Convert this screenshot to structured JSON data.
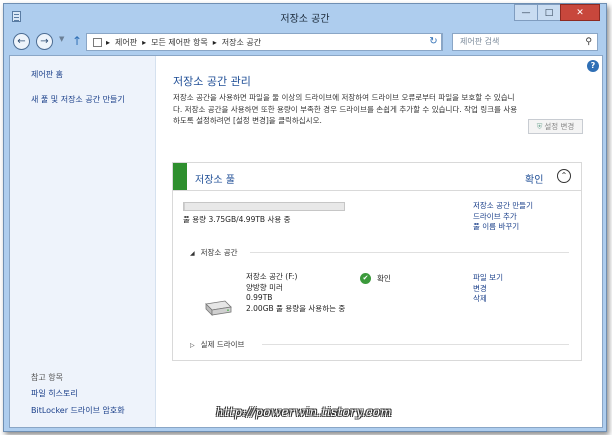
{
  "window": {
    "title": "저장소 공간",
    "buttons": {
      "minimize": "—",
      "maximize": "□",
      "close": "✕"
    }
  },
  "address_bar": {
    "back": "←",
    "forward": "→",
    "up": "↑",
    "path": [
      "제어판",
      "모든 제어판 항목",
      "저장소 공간"
    ],
    "separator": "▸",
    "refresh": "↻",
    "search_placeholder": "제어판 검색",
    "search_icon": "magnifier-icon"
  },
  "sidebar": {
    "home_link": "제어판 홈",
    "create_link": "새 풀 및 저장소 공간 만들기",
    "see_also_header": "참고 항목",
    "see_also": [
      "파일 히스토리",
      "BitLocker 드라이브 암호화"
    ]
  },
  "main": {
    "heading": "저장소 공간 관리",
    "description": "저장소 공간을 사용하면 파일을 둘 이상의 드라이브에 저장하여 드라이브 오류로부터 파일을 보호할 수 있습니다. 저장소 공간을 사용하면 또한 용량이 부족한 경우 드라이브를 손쉽게 추가할 수 있습니다. 작업 링크를 사용하도록 설정하려면 [설정 변경]을 클릭하십시오.",
    "change_settings": "설정 변경",
    "help": "?"
  },
  "pool": {
    "title": "저장소 풀",
    "status": "확인",
    "usage_text": "풀 용량 3.75GB/4.99TB 사용 중",
    "usage_fraction": 0.001,
    "links": [
      "저장소 공간 만들기",
      "드라이브 추가",
      "풀 이름 바꾸기"
    ],
    "spaces_header": "저장소 공간",
    "space": {
      "name": "저장소 공간 (F:)",
      "type": "양방향 미러",
      "size": "0.99TB",
      "usage": "2.00GB 풀 용량을 사용하는 중",
      "status": "확인",
      "links": [
        "파일 보기",
        "변경",
        "삭제"
      ]
    },
    "drives_header": "실제 드라이브"
  },
  "watermark": "http://powerwin.tistory.com"
}
